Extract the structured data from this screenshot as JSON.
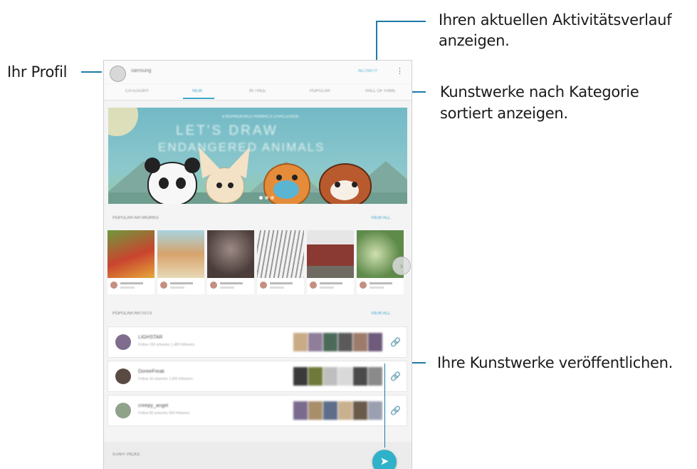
{
  "callouts": {
    "profile": "Ihr Profil",
    "activity_line1": "Ihren aktuellen Aktivitätsverlauf",
    "activity_line2": "anzeigen.",
    "categories_line1": "Kunstwerke nach Kategorie",
    "categories_line2": "sortiert anzeigen.",
    "publish": "Ihre Kunstwerke veröffentlichen."
  },
  "app": {
    "username": "samsung",
    "activity_label": "ACTIVITY",
    "more_icon": "⋮",
    "tabs": [
      "CATEGORY",
      "NEW",
      "IN TREE",
      "POPULAR",
      "HALL OF FAME"
    ],
    "active_tab_index": 1,
    "banner": {
      "subtitle": "ENDANGERED ANIMALS CHALLENGE",
      "title_line1": "LET'S DRAW",
      "title_line2": "ENDANGERED ANIMALS"
    },
    "popular_artworks": {
      "heading": "POPULAR ARTWORKS",
      "view_all": "VIEW ALL"
    },
    "popular_artists": {
      "heading": "POPULAR ARTISTS",
      "view_all": "VIEW ALL",
      "items": [
        {
          "name": "LIGHSTAR",
          "sub": "Follow 150 artworks 1,485 followers"
        },
        {
          "name": "DoreeFreak",
          "sub": "Follow 30 artworks 1,000 followers"
        },
        {
          "name": "creepy_angel",
          "sub": "Follow 80 artworks 900 followers"
        }
      ]
    },
    "staff_picks": "STAFF PICKS",
    "fab_icon": "send-icon",
    "link_icon": "link-icon",
    "colors": {
      "accent": "#3fa7c9",
      "fab": "#2fb2c9",
      "callout_line": "#1f7aa8"
    }
  }
}
